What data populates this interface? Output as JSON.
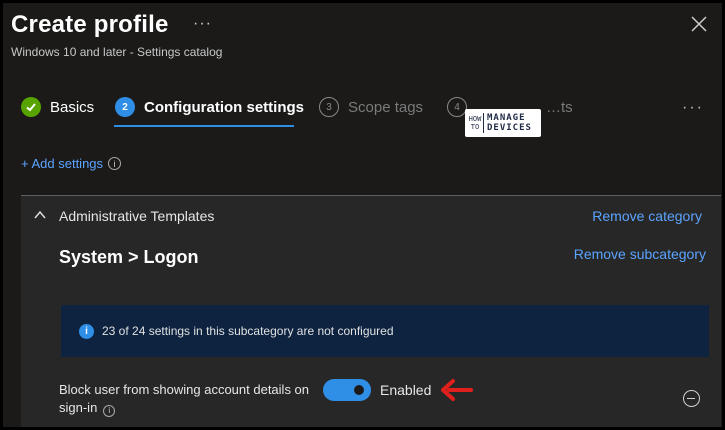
{
  "header": {
    "title": "Create profile",
    "more": "···",
    "subtitle": "Windows 10 and later - Settings catalog"
  },
  "steps": [
    {
      "number": "✓",
      "label": "Basics",
      "state": "done"
    },
    {
      "number": "2",
      "label": "Configuration settings",
      "state": "active"
    },
    {
      "number": "3",
      "label": "Scope tags",
      "state": "pending"
    },
    {
      "number": "4",
      "label": "…ts",
      "state": "pending"
    }
  ],
  "steps_more": "···",
  "watermark": {
    "how_to": "HOW TO",
    "line1": "MANAGE",
    "line2": "DEVICES"
  },
  "add_settings": "+ Add settings",
  "category": {
    "name": "Administrative Templates",
    "remove_label": "Remove category",
    "subcategory": "System > Logon",
    "remove_sub_label": "Remove subcategory"
  },
  "banner": {
    "icon": "i",
    "text": "23 of 24 settings in this subcategory are not configured"
  },
  "setting": {
    "label": "Block user from showing account details on sign-in",
    "value": "Enabled",
    "toggle_on": true
  },
  "colors": {
    "accent": "#2f8fe6",
    "link": "#5ba4ff",
    "arrow": "#e0201c",
    "success": "#57a300"
  },
  "icons": [
    "more-icon",
    "close-icon",
    "check-icon",
    "info-icon",
    "chevron-up-icon",
    "arrow-left-icon",
    "remove-circle-icon"
  ]
}
